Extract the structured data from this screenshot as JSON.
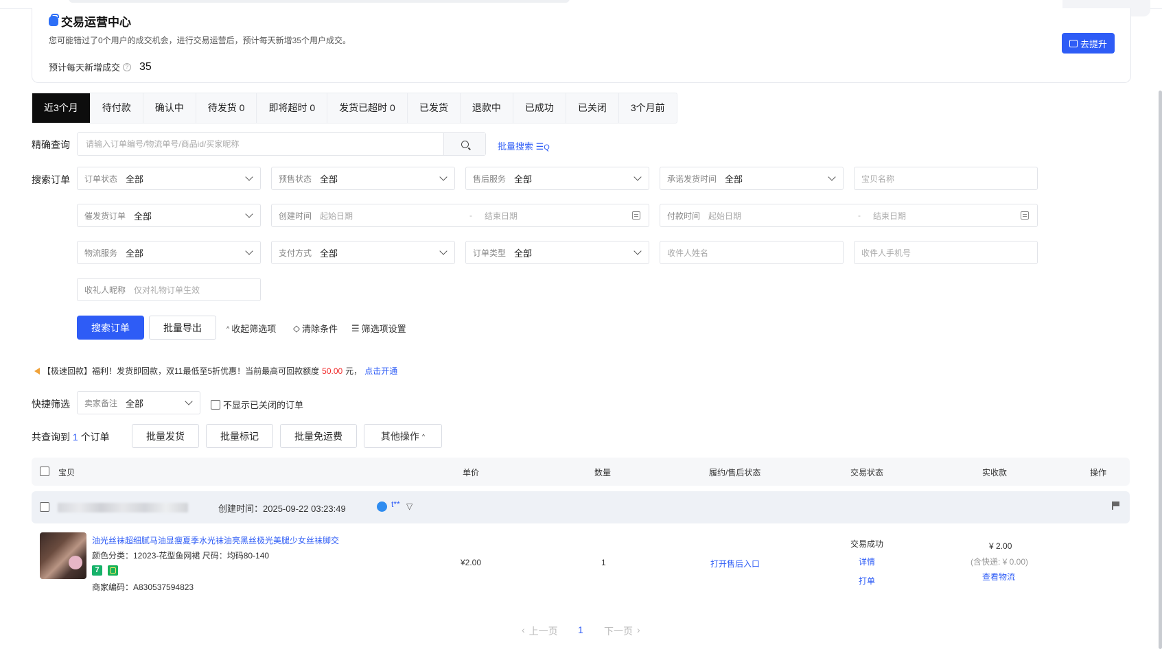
{
  "header": {
    "title": "交易运营中心",
    "description": "您可能错过了0个用户的成交机会，进行交易运营后，预计每天新增35个用户成交。",
    "stat_label": "预计每天新增成交",
    "stat_value": "35",
    "improve_button": "去提升"
  },
  "tabs": [
    "近3个月",
    "待付款",
    "确认中",
    "待发货 0",
    "即将超时 0",
    "发货已超时 0",
    "已发货",
    "退款中",
    "已成功",
    "已关闭",
    "3个月前"
  ],
  "exact_search": {
    "label": "精确查询",
    "placeholder": "请输入订单编号/物流单号/商品id/买家昵称",
    "batch_search": "批量搜索"
  },
  "filters": {
    "label": "搜索订单",
    "order_status": {
      "label": "订单状态",
      "value": "全部"
    },
    "presale_status": {
      "label": "预售状态",
      "value": "全部"
    },
    "after_sale": {
      "label": "售后服务",
      "value": "全部"
    },
    "promise_ship_time": {
      "label": "承诺发货时间",
      "value": "全部"
    },
    "item_name": {
      "placeholder": "宝贝名称"
    },
    "urge_ship": {
      "label": "催发货订单",
      "value": "全部"
    },
    "create_time": {
      "label": "创建时间",
      "start": "起始日期",
      "end": "结束日期"
    },
    "pay_time": {
      "label": "付款时间",
      "start": "起始日期",
      "end": "结束日期"
    },
    "logistics": {
      "label": "物流服务",
      "value": "全部"
    },
    "pay_method": {
      "label": "支付方式",
      "value": "全部"
    },
    "order_type": {
      "label": "订单类型",
      "value": "全部"
    },
    "receiver_name": {
      "placeholder": "收件人姓名"
    },
    "receiver_phone": {
      "placeholder": "收件人手机号"
    },
    "gift_nick": {
      "label": "收礼人昵称",
      "placeholder": "仅对礼物订单生效"
    }
  },
  "actions": {
    "search": "搜索订单",
    "export": "批量导出",
    "collapse": "收起筛选项",
    "clear": "清除条件",
    "settings": "筛选项设置"
  },
  "notice": {
    "prefix": "【极速回款】福利！发货即回款，双11最低至5折优惠！当前最高可回款额度",
    "amount": "50.00",
    "suffix": "元，",
    "link": "点击开通"
  },
  "quick": {
    "label": "快捷筛选",
    "remark_label": "卖家备注",
    "remark_value": "全部",
    "hide_closed": "不显示已关闭的订单"
  },
  "result": {
    "prefix": "共查询到",
    "count": "1",
    "suffix": "个订单",
    "batch_ship": "批量发货",
    "batch_mark": "批量标记",
    "batch_free": "批量免运费",
    "more": "其他操作"
  },
  "table": {
    "headers": [
      "宝贝",
      "单价",
      "数量",
      "履约/售后状态",
      "交易状态",
      "实收款",
      "操作"
    ]
  },
  "order": {
    "created": "创建时间：2025-09-22 03:23:49",
    "buyer": "t**",
    "product_title": "油光丝袜超细腻马油显瘦夏季水光袜油亮黑丝极光美腿少女丝袜脚交",
    "sku": "颜色分类：12023-花型鱼网裙   尺码：均码80-140",
    "merchant_code": "商家编码：A830537594823",
    "badge": "7",
    "price": "¥2.00",
    "qty": "1",
    "after_sale_link": "打开售后入口",
    "status": "交易成功",
    "detail": "详情",
    "print": "打单",
    "received": "¥ 2.00",
    "shipping_note": "(含快递: ¥ 0.00)",
    "logistics_link": "查看物流"
  },
  "pager": {
    "prev": "上一页",
    "page": "1",
    "next": "下一页"
  }
}
